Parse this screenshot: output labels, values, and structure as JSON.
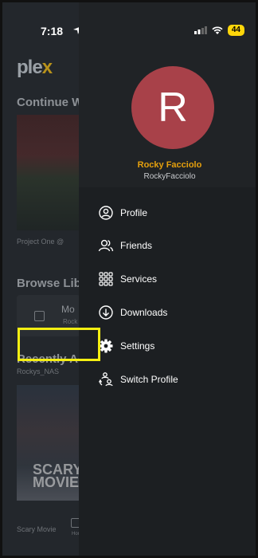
{
  "status_bar": {
    "time": "7:18",
    "battery": "44"
  },
  "background": {
    "logo_pl": "ple",
    "logo_x": "x",
    "continue_heading": "Continue W",
    "continue_caption": "Project One @",
    "browse_heading": "Browse Libr",
    "library_name": "Mo",
    "library_sub": "Rock",
    "recent_heading": "Recently Ac",
    "recent_sub": "Rockys_NAS",
    "poster_text": "SCARY\nMOVIE",
    "poster_caption": "Scary Movie",
    "home_label": "Hom"
  },
  "profile": {
    "initial": "R",
    "name": "Rocky Facciolo",
    "handle": "RockyFacciolo",
    "avatar_color": "#a84149",
    "name_color": "#e5a00d"
  },
  "menu": [
    {
      "label": "Profile",
      "icon": "profile-icon"
    },
    {
      "label": "Friends",
      "icon": "friends-icon"
    },
    {
      "label": "Services",
      "icon": "grid-icon"
    },
    {
      "label": "Downloads",
      "icon": "download-icon"
    },
    {
      "label": "Settings",
      "icon": "gear-icon"
    },
    {
      "label": "Switch Profile",
      "icon": "switch-profile-icon"
    }
  ],
  "highlight_color": "#f5ef12"
}
